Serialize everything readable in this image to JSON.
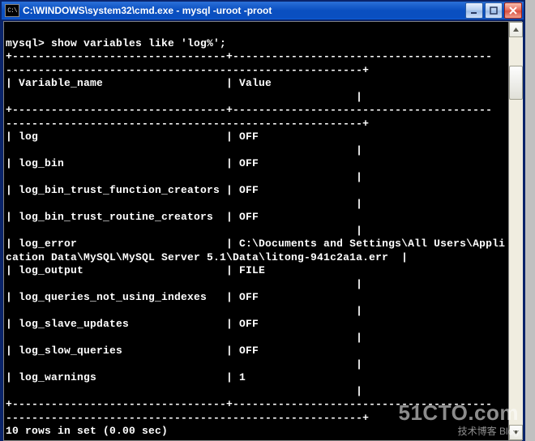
{
  "window": {
    "icon_label": "C:\\",
    "title": "C:\\WINDOWS\\system32\\cmd.exe - mysql -uroot -proot"
  },
  "term": {
    "prompt": "mysql>",
    "command": "show variables like 'log%';",
    "col_variable": "Variable_name",
    "col_value": "Value",
    "rows": [
      {
        "name": "log",
        "value": "OFF"
      },
      {
        "name": "log_bin",
        "value": "OFF"
      },
      {
        "name": "log_bin_trust_function_creators",
        "value": "OFF"
      },
      {
        "name": "log_bin_trust_routine_creators",
        "value": "OFF"
      },
      {
        "name": "log_error",
        "value": "C:\\Documents and Settings\\All Users\\Application Data\\MySQL\\MySQL Server 5.1\\Data\\litong-941c2a1a.err"
      },
      {
        "name": "log_output",
        "value": "FILE"
      },
      {
        "name": "log_queries_not_using_indexes",
        "value": "OFF"
      },
      {
        "name": "log_slave_updates",
        "value": "OFF"
      },
      {
        "name": "log_slow_queries",
        "value": "OFF"
      },
      {
        "name": "log_warnings",
        "value": "1"
      }
    ],
    "summary": "10 rows in set (0.00 sec)"
  },
  "watermark": {
    "main": "51CTO.com",
    "sub": "技术博客    Blog"
  }
}
